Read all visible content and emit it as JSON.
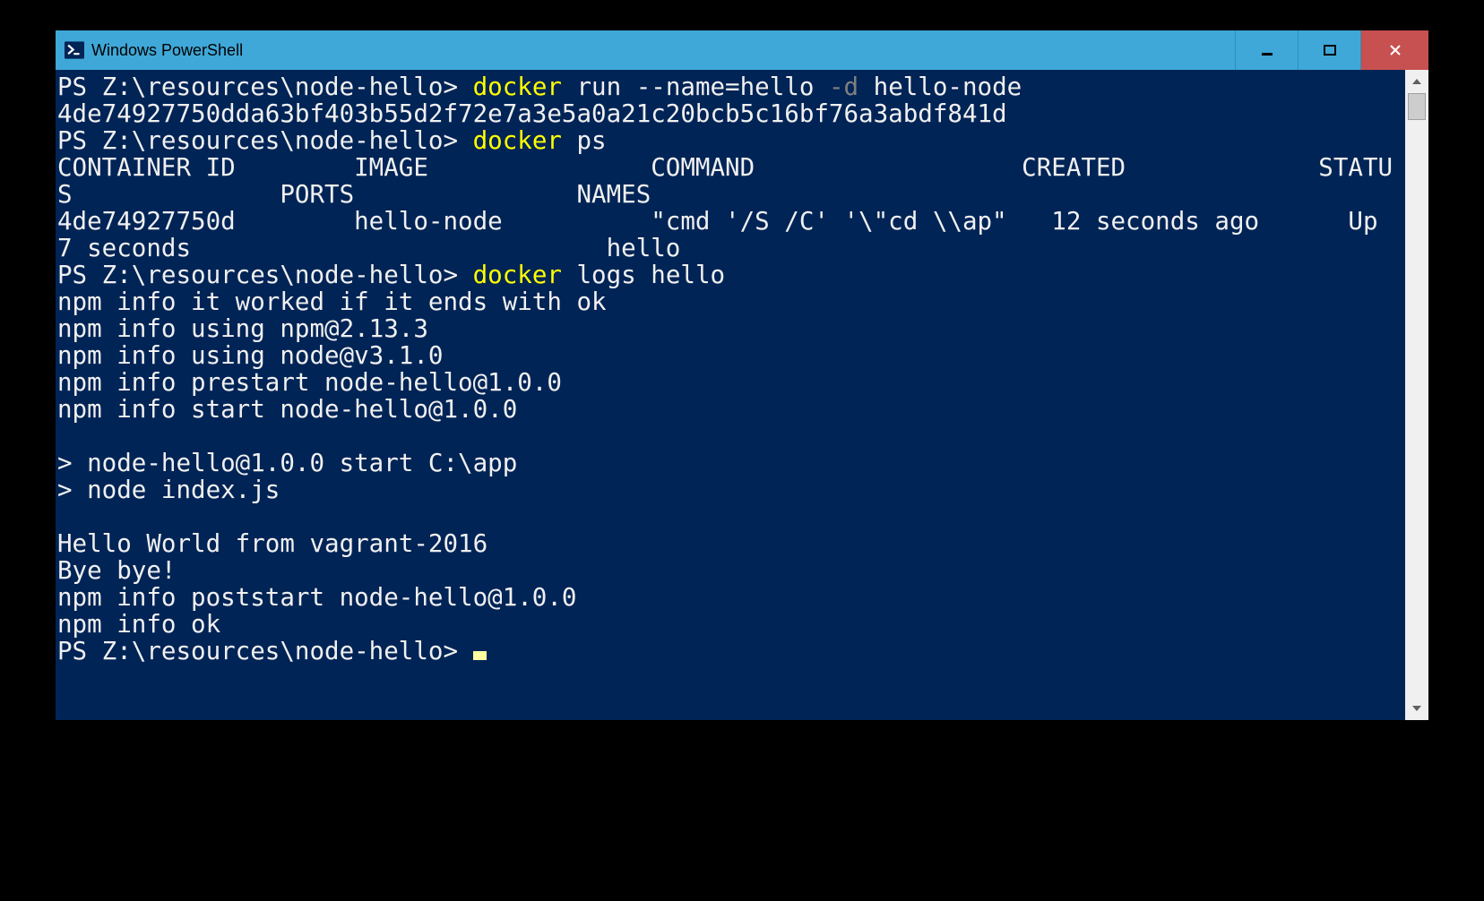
{
  "window": {
    "title": "Windows PowerShell"
  },
  "session": {
    "prompt": "PS Z:\\resources\\node-hello>",
    "commands": [
      {
        "cmd": "docker",
        "args_plain_before_flag": "run --name=hello",
        "flag": "-d",
        "args_after_flag": "hello-node"
      },
      {
        "cmd": "docker",
        "args": "ps"
      },
      {
        "cmd": "docker",
        "args": "logs hello"
      }
    ],
    "container_id_full": "4de74927750dda63bf403b55d2f72e7a3e5a0a21c20bcb5c16bf76a3abdf841d",
    "ps_header": "CONTAINER ID        IMAGE               COMMAND                  CREATED             STATUS              PORTS               NAMES",
    "ps_row": "4de74927750d        hello-node          \"cmd '/S /C' '\\\"cd \\\\ap\"   12 seconds ago      Up 7 seconds                            hello",
    "logs": [
      "npm info it worked if it ends with ok",
      "npm info using npm@2.13.3",
      "npm info using node@v3.1.0",
      "npm info prestart node-hello@1.0.0",
      "npm info start node-hello@1.0.0",
      "",
      "> node-hello@1.0.0 start C:\\app",
      "> node index.js",
      "",
      "Hello World from vagrant-2016",
      "Bye bye!",
      "npm info poststart node-hello@1.0.0",
      "npm info ok"
    ]
  }
}
